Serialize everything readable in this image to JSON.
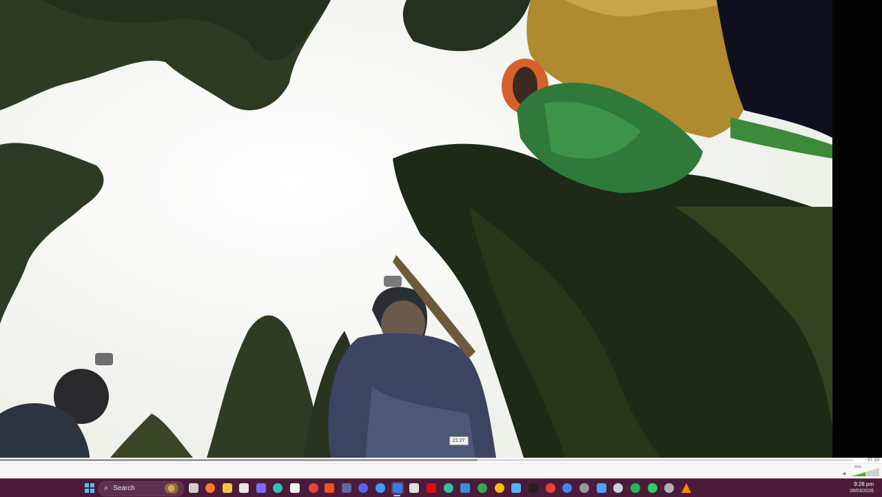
{
  "player": {
    "hover_time": "21:27",
    "remaining_time": "-37:10",
    "progress": 0.56,
    "volume_label": "50%",
    "volume": 0.5
  },
  "taskbar": {
    "search_placeholder": "Search",
    "clock_time": "9:28 pm",
    "clock_date": "28/03/2026",
    "icons": [
      {
        "name": "start-icon",
        "color": "#4cc2ff"
      },
      {
        "name": "task-view-icon",
        "color": "#cfcfcf"
      },
      {
        "name": "firefox-icon",
        "color": "#ff7a2f"
      },
      {
        "name": "file-explorer-icon",
        "color": "#f6c445"
      },
      {
        "name": "chatgpt-icon",
        "color": "#e8e8e8"
      },
      {
        "name": "copilot-icon",
        "color": "#7a6cff"
      },
      {
        "name": "edge-icon",
        "color": "#2ec4b6"
      },
      {
        "name": "calendar-icon",
        "color": "#f2f2f2"
      },
      {
        "name": "chrome-icon",
        "color": "#ea4335"
      },
      {
        "name": "office-icon",
        "color": "#f25022"
      },
      {
        "name": "teams-icon",
        "color": "#6264a7"
      },
      {
        "name": "discord-icon",
        "color": "#5865f2"
      },
      {
        "name": "vpn-icon",
        "color": "#3aa0ff"
      },
      {
        "name": "remote-desktop-icon",
        "color": "#2f80ed"
      },
      {
        "name": "mail-icon",
        "color": "#e0e0e0"
      },
      {
        "name": "netflix-icon",
        "color": "#e50914"
      },
      {
        "name": "globe-icon",
        "color": "#39c0a0"
      },
      {
        "name": "photos-icon",
        "color": "#3a8fd8"
      },
      {
        "name": "chrome-profile-icon",
        "color": "#34a853"
      },
      {
        "name": "chrome-profile-2-icon",
        "color": "#fbbc05"
      },
      {
        "name": "notepad-icon",
        "color": "#4fb3ff"
      },
      {
        "name": "terminal-icon",
        "color": "#222222"
      },
      {
        "name": "chrome-profile-3-icon",
        "color": "#ea4335"
      },
      {
        "name": "chrome-profile-4-icon",
        "color": "#4285f4"
      },
      {
        "name": "obs-icon",
        "color": "#9a9a9a"
      },
      {
        "name": "screenshot-icon",
        "color": "#4aa3ff"
      },
      {
        "name": "steam-icon",
        "color": "#c6d4df"
      },
      {
        "name": "spotify-icon",
        "color": "#1db954"
      },
      {
        "name": "whatsapp-icon",
        "color": "#25d366"
      },
      {
        "name": "settings-icon",
        "color": "#b0b0b0"
      },
      {
        "name": "vlc-icon",
        "color": "#ff8800"
      }
    ]
  }
}
